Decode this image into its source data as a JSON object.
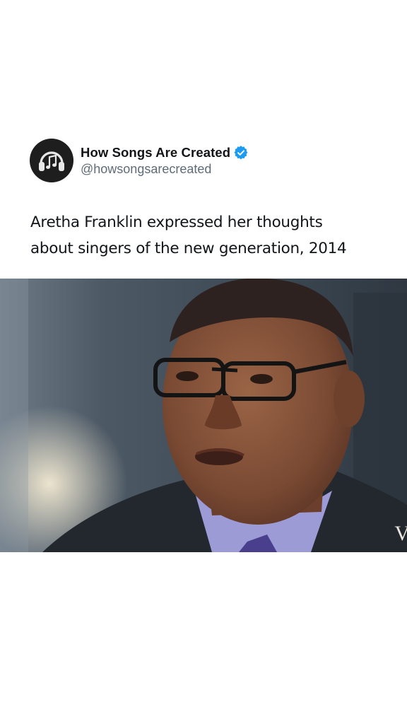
{
  "post": {
    "author": {
      "display_name": "How Songs Are Created",
      "handle": "@howsongsarecreated",
      "verified": true,
      "avatar_icon": "headphones-music-note-icon"
    },
    "caption_lines": [
      "Aretha Franklin expressed her thoughts",
      "about singers of the new generation, 2014"
    ],
    "media": {
      "type": "video-frame",
      "watermark": "V"
    }
  },
  "colors": {
    "background": "#ffffff",
    "verified_badge": "#1d9bf0",
    "handle": "#5f6b78",
    "avatar_bg": "#1e1e1e"
  }
}
